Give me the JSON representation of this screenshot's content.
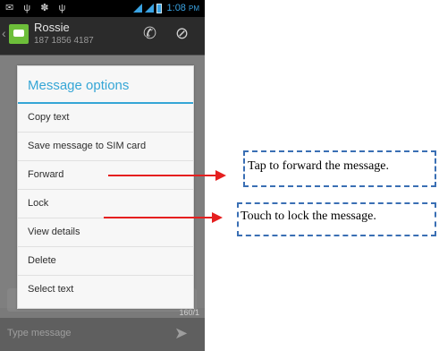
{
  "status_bar": {
    "time": "1:08",
    "ampm": "PM",
    "left_icons": [
      "notification-icon",
      "usb-icon",
      "android-icon",
      "usb-icon"
    ],
    "right_icons": [
      "signal-icon",
      "signal-icon",
      "battery-icon"
    ],
    "accent_color": "#3aa3e3"
  },
  "contact": {
    "name": "Rossie",
    "number": "187 1856 4187"
  },
  "dialog": {
    "title": "Message options",
    "title_color": "#35a6d6",
    "items": [
      {
        "label": "Copy text"
      },
      {
        "label": "Save message to SIM card"
      },
      {
        "label": "Forward"
      },
      {
        "label": "Lock"
      },
      {
        "label": "View details"
      },
      {
        "label": "Delete"
      },
      {
        "label": "Select text"
      }
    ]
  },
  "composer": {
    "placeholder": "Type message",
    "counter": "160/1"
  },
  "annotations": [
    {
      "text": "Tap to forward the message.",
      "target": "Forward"
    },
    {
      "text": "Touch to lock the message.",
      "target": "Lock"
    }
  ],
  "annotation_colors": {
    "arrow": "#e51f1f",
    "box": "#3a6fb4"
  }
}
